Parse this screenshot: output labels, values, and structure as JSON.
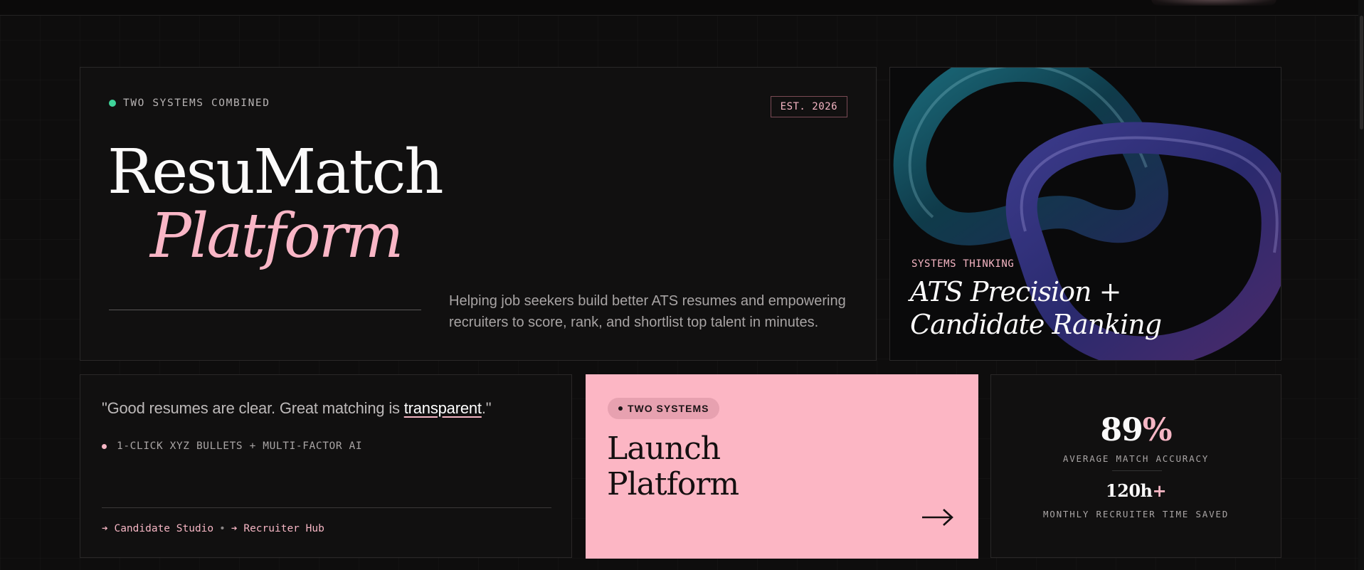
{
  "hero": {
    "eyebrow": "TWO SYSTEMS COMBINED",
    "badge": "EST. 2026",
    "title": "ResuMatch",
    "subtitle": "Platform",
    "description": "Helping job seekers build better ATS resumes and empowering recruiters to score, rank, and shortlist top talent in minutes."
  },
  "visual": {
    "label": "SYSTEMS THINKING",
    "title_line1": "ATS Precision +",
    "title_line2": "Candidate Ranking"
  },
  "quote": {
    "text_before": "\"Good resumes are clear. Great matching is ",
    "highlight": "transparent",
    "text_after": ".\"",
    "bullet": "1-CLICK XYZ BULLETS + MULTI-FACTOR AI",
    "link1": "➔ Candidate Studio",
    "separator": "•",
    "link2": "➔ Recruiter Hub"
  },
  "launch": {
    "chip": "TWO SYSTEMS",
    "title_line1": "Launch",
    "title_line2": "Platform"
  },
  "stats": {
    "stat1_value": "89",
    "stat1_suffix": "%",
    "stat1_caption": "AVERAGE MATCH ACCURACY",
    "stat2_value": "120h",
    "stat2_suffix": "+",
    "stat2_caption": "MONTHLY RECRUITER TIME SAVED"
  },
  "colors": {
    "accent_pink": "#f6b6c4",
    "launch_bg": "#fcb6c4",
    "status_green": "#3fd49a",
    "background": "#0e0d0d"
  },
  "icons": [
    "arrow-right-icon",
    "status-dot-icon"
  ]
}
